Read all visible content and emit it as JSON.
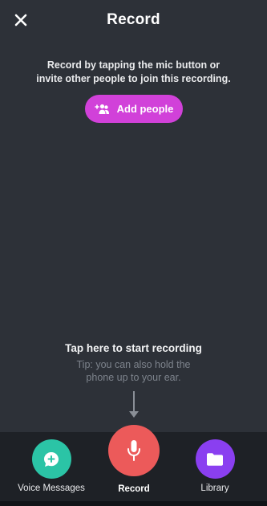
{
  "header": {
    "title": "Record",
    "close_icon": "close-icon"
  },
  "intro": {
    "line1": "Record by tapping the mic button or",
    "line2": "invite other people to join this recording."
  },
  "add_people": {
    "label": "Add people",
    "icon": "add-person-icon",
    "color": "#d141d9"
  },
  "hint": {
    "title": "Tap here to start recording",
    "tip_line1": "Tip: you can also hold the",
    "tip_line2": "phone up to your ear."
  },
  "bottom_nav": {
    "voice_messages": {
      "label": "Voice Messages",
      "icon": "chat-plus-icon",
      "color": "#2bc4a6"
    },
    "record": {
      "label": "Record",
      "icon": "mic-icon",
      "color": "#ec5a5a"
    },
    "library": {
      "label": "Library",
      "icon": "folder-icon",
      "color": "#8a3ff0"
    }
  },
  "colors": {
    "background": "#2d3138",
    "bottom_bar": "#1e2126"
  }
}
